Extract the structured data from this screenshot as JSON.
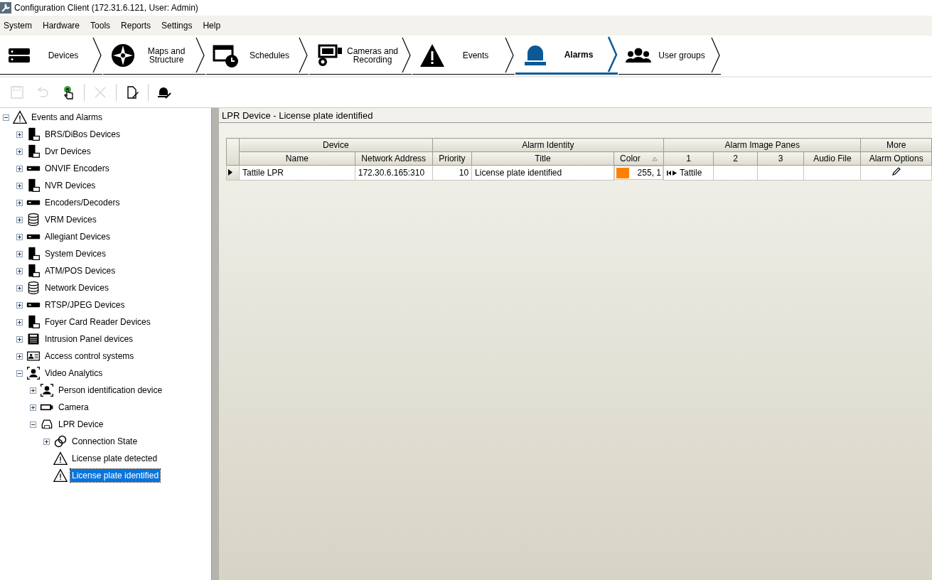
{
  "window": {
    "title": "Configuration Client (172.31.6.121, User: Admin)"
  },
  "menu": [
    "System",
    "Hardware",
    "Tools",
    "Reports",
    "Settings",
    "Help"
  ],
  "nav_tabs": [
    {
      "label": "Devices",
      "selected": false,
      "kind": "devices"
    },
    {
      "label": "Maps and Structure",
      "selected": false,
      "kind": "maps"
    },
    {
      "label": "Schedules",
      "selected": false,
      "kind": "schedules"
    },
    {
      "label": "Cameras and Recording",
      "selected": false,
      "kind": "cameras"
    },
    {
      "label": "Events",
      "selected": false,
      "kind": "events"
    },
    {
      "label": "Alarms",
      "selected": true,
      "kind": "alarms"
    },
    {
      "label": "User groups",
      "selected": false,
      "kind": "users"
    }
  ],
  "toolbar": [
    {
      "kind": "save",
      "disabled": true
    },
    {
      "kind": "undo",
      "disabled": true
    },
    {
      "kind": "hand",
      "disabled": false
    },
    {
      "kind": "sep"
    },
    {
      "kind": "delete",
      "disabled": true
    },
    {
      "kind": "sep"
    },
    {
      "kind": "edit",
      "disabled": false
    },
    {
      "kind": "sep"
    },
    {
      "kind": "alarm",
      "disabled": false
    }
  ],
  "tree": [
    {
      "label": "Events and Alarms",
      "kind": "event",
      "expanded": true,
      "selected": false,
      "children": [
        {
          "label": "BRS/DiBos Devices",
          "kind": "device",
          "expanded": false,
          "selected": false
        },
        {
          "label": "Dvr Devices",
          "kind": "device",
          "expanded": false,
          "selected": false
        },
        {
          "label": "ONVIF Encoders",
          "kind": "encoder",
          "expanded": false,
          "selected": false
        },
        {
          "label": "NVR Devices",
          "kind": "device",
          "expanded": false,
          "selected": false
        },
        {
          "label": "Encoders/Decoders",
          "kind": "encoder",
          "expanded": false,
          "selected": false
        },
        {
          "label": "VRM Devices",
          "kind": "storage",
          "expanded": false,
          "selected": false
        },
        {
          "label": "Allegiant Devices",
          "kind": "encoder",
          "expanded": false,
          "selected": false
        },
        {
          "label": "System Devices",
          "kind": "device",
          "expanded": false,
          "selected": false
        },
        {
          "label": "ATM/POS Devices",
          "kind": "device",
          "expanded": false,
          "selected": false
        },
        {
          "label": "Network Devices",
          "kind": "storage",
          "expanded": false,
          "selected": false
        },
        {
          "label": "RTSP/JPEG Devices",
          "kind": "encoder",
          "expanded": false,
          "selected": false
        },
        {
          "label": "Foyer Card Reader Devices",
          "kind": "device",
          "expanded": false,
          "selected": false
        },
        {
          "label": "Intrusion Panel devices",
          "kind": "keypad",
          "expanded": false,
          "selected": false
        },
        {
          "label": "Access control systems",
          "kind": "card",
          "expanded": false,
          "selected": false
        },
        {
          "label": "Video Analytics",
          "kind": "person",
          "expanded": true,
          "selected": false,
          "children": [
            {
              "label": "Person identification device",
              "kind": "person",
              "expanded": false,
              "selected": false
            },
            {
              "label": "Camera",
              "kind": "camera",
              "expanded": false,
              "selected": false
            },
            {
              "label": "LPR Device",
              "kind": "car",
              "expanded": true,
              "selected": false,
              "children": [
                {
                  "label": "Connection State",
                  "kind": "link",
                  "expanded": false,
                  "selected": false
                },
                {
                  "label": "License plate detected",
                  "kind": "event",
                  "selected": false
                },
                {
                  "label": "License plate identified",
                  "kind": "event",
                  "selected": true
                }
              ]
            }
          ]
        }
      ]
    }
  ],
  "panel": {
    "title": "LPR Device - License plate identified"
  },
  "grid": {
    "groups": [
      "Device",
      "Alarm Identity",
      "Alarm Image Panes",
      "More"
    ],
    "columns": [
      "Name",
      "Network Address",
      "Priority",
      "Title",
      "Color",
      "1",
      "2",
      "3",
      "Audio File",
      "Alarm Options"
    ],
    "rows": [
      {
        "selected": true,
        "name": "Tattile LPR",
        "address": "172.30.6.165:310",
        "priority": "10",
        "title": "License plate identified",
        "color": "#ff8000",
        "color_text": "255, 1",
        "pane_1": "Tattile"
      }
    ]
  }
}
